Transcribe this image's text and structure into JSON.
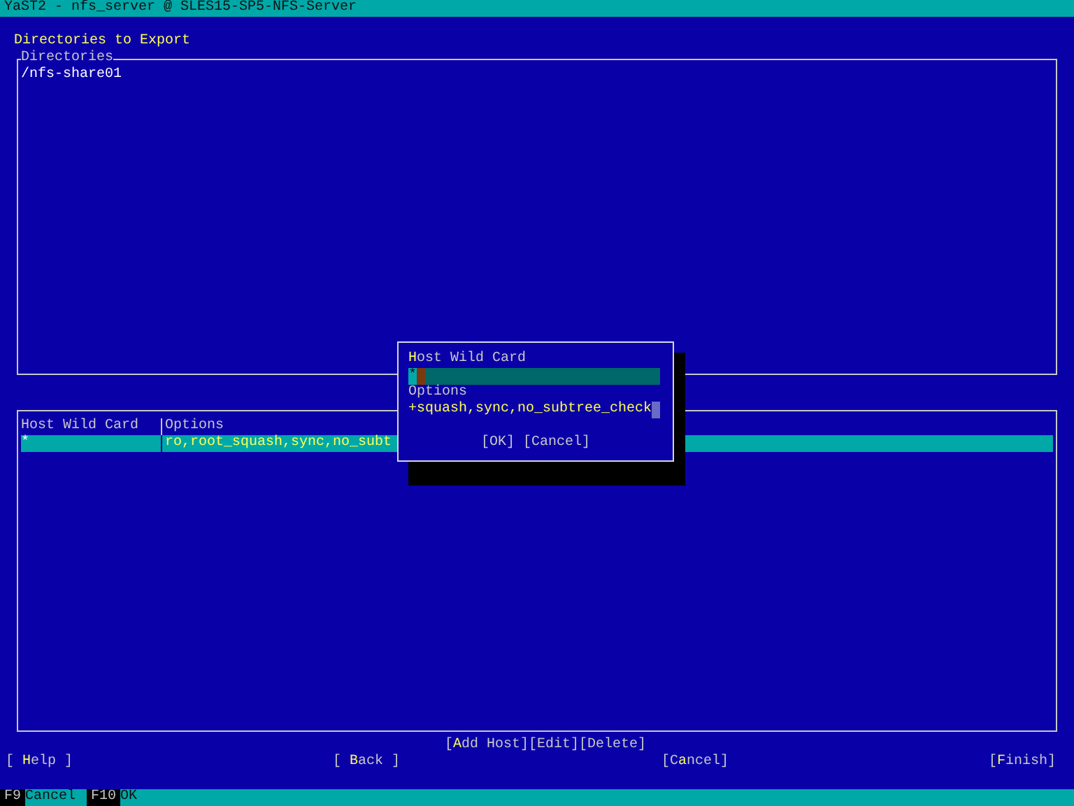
{
  "window": {
    "title": "YaST2 - nfs_server @ SLES15-SP5-NFS-Server"
  },
  "heading": "Directories to Export",
  "directories": {
    "label": "Directories",
    "items": [
      {
        "path": "/nfs-share01",
        "selected": false
      }
    ]
  },
  "hosts_table": {
    "columns": [
      "Host Wild Card",
      "Options"
    ],
    "rows": [
      {
        "cells": [
          "*",
          "ro,root_squash,sync,no_subt"
        ],
        "selected": true
      }
    ]
  },
  "table_buttons": [
    {
      "parts": [
        {
          "text": "[",
          "hotkey": false
        },
        {
          "text": "A",
          "hotkey": true
        },
        {
          "text": "dd Host]",
          "hotkey": false
        }
      ]
    },
    {
      "parts": [
        {
          "text": "[Edit]",
          "hotkey": false
        }
      ]
    },
    {
      "parts": [
        {
          "text": "[Delete]",
          "hotkey": false
        }
      ]
    }
  ],
  "nav_buttons": [
    {
      "parts": [
        {
          "text": "[ ",
          "hotkey": false
        },
        {
          "text": "H",
          "hotkey": true
        },
        {
          "text": "elp ]",
          "hotkey": false
        }
      ]
    },
    {
      "parts": [
        {
          "text": "[ ",
          "hotkey": false
        },
        {
          "text": "B",
          "hotkey": true
        },
        {
          "text": "ack ]",
          "hotkey": false
        }
      ]
    },
    {
      "parts": [
        {
          "text": "[C",
          "hotkey": false
        },
        {
          "text": "a",
          "hotkey": true
        },
        {
          "text": "ncel]",
          "hotkey": false
        }
      ]
    },
    {
      "parts": [
        {
          "text": "[",
          "hotkey": false
        },
        {
          "text": "F",
          "hotkey": true
        },
        {
          "text": "inish]",
          "hotkey": false
        }
      ]
    }
  ],
  "dialog": {
    "fields": [
      {
        "label_parts": [
          {
            "text": "H",
            "hotkey": true
          },
          {
            "text": "ost Wild Card",
            "hotkey": false
          }
        ],
        "value": "*",
        "focused": true
      },
      {
        "label_parts": [
          {
            "text": "Options",
            "hotkey": false
          }
        ],
        "value": "+squash,sync,no_subtree_check",
        "focused": false
      }
    ],
    "buttons": [
      "[OK]",
      "[Cancel]"
    ]
  },
  "function_keys": [
    {
      "key": "F9",
      "label": "Cancel"
    },
    {
      "key": "F10",
      "label": "OK"
    }
  ]
}
